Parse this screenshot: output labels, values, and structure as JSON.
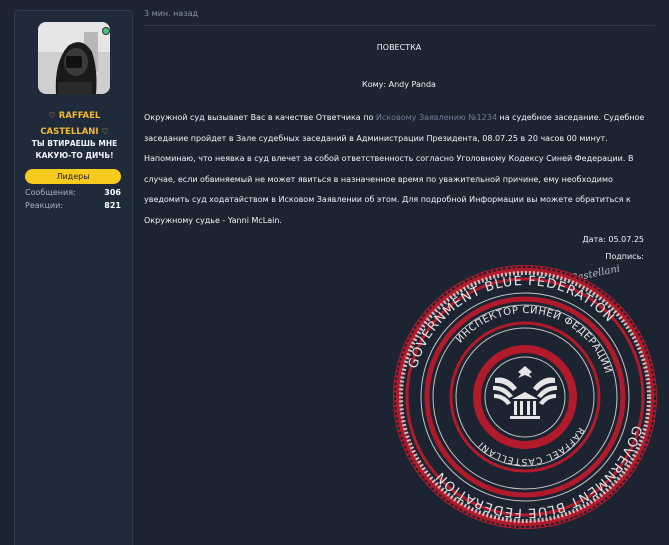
{
  "post": {
    "time": "3 мин. назад",
    "heading": "ПОВЕСТКА",
    "recipient": "Кому: Andy Panda",
    "body_pre": "Окружной суд вызывает Вас в качестве Ответчика по ",
    "body_link": "Исковому Заявлению №1234",
    "body_post": " на судебное заседание. Судебное заседание пройдет в Зале судебных заседаний в Администрации Президента, 08.07.25 в 20 часов 00 минут. Напоминаю, что неявка в суд влечет за собой ответственность согласно Уголовному Кодексу Синей Федерации. В случае, если обвиняемый не может явиться в назначенное время по уважительной причине, ему необходимо уведомить суд ходатайством в Исковом Заявлении об этом. Для подробной Информации вы можете обратиться к Окружному судье - Yanni McLain.",
    "date": "Дата: 05.07.25",
    "signature_label": "Подпись:",
    "signature_text": "R. Castellani"
  },
  "user": {
    "name_line1": "RAFFAEL",
    "name_line2": "CASTELLANI",
    "title": "ТЫ ВТИРАЕШЬ МНЕ КАКУЮ-ТО ДИЧЬ!",
    "badge": "Лидеры",
    "stats": [
      {
        "label": "Сообщения:",
        "value": "306"
      },
      {
        "label": "Реакции:",
        "value": "821"
      }
    ]
  },
  "seal": {
    "outer_text": "GOVERNMENT BLUE FEDERATION",
    "inner_text": "ИНСПЕКТОР СИНЕЙ ФЕДЕРАЦИИ",
    "name_text": "RAFFAEL CASTELLANI"
  },
  "colors": {
    "background": "#1c2331",
    "accent_gold": "#f2b92f",
    "badge_yellow": "#f7cb1e",
    "seal_red": "#b01a2b",
    "online": "#4fc27a"
  }
}
